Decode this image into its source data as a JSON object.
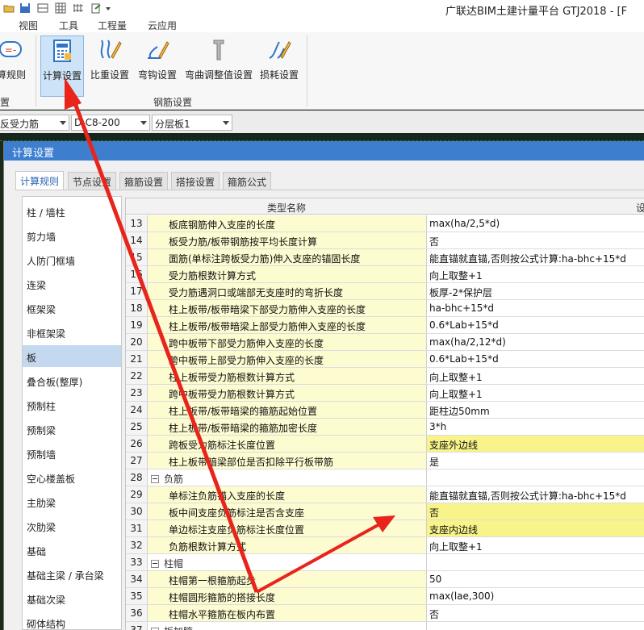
{
  "app": {
    "title": "广联达BIM土建计量平台 GTJ2018 - [F"
  },
  "menu": {
    "tabs": [
      "视图",
      "工具",
      "工程量",
      "云应用"
    ]
  },
  "ribbon": {
    "left_partial_button": "算规则",
    "left_partial_group": "置",
    "buttons": [
      "计算设置",
      "比重设置",
      "弯钩设置",
      "弯曲调整值设置",
      "损耗设置"
    ],
    "group_label": "钢筋设置"
  },
  "toolbar": {
    "combo1": "反受力筋",
    "combo2": "D-C8-200",
    "combo3": "分层板1"
  },
  "dialog": {
    "title": "计算设置",
    "tabs": [
      "计算规则",
      "节点设置",
      "箍筋设置",
      "搭接设置",
      "箍筋公式"
    ],
    "active_tab": 0,
    "categories": [
      "柱 / 墙柱",
      "剪力墙",
      "人防门框墙",
      "连梁",
      "框架梁",
      "非框架梁",
      "板",
      "叠合板(整厚)",
      "预制柱",
      "预制梁",
      "预制墙",
      "空心楼盖板",
      "主肋梁",
      "次肋梁",
      "基础",
      "基础主梁 / 承台梁",
      "基础次梁",
      "砌体结构"
    ],
    "selected_category": 6,
    "table": {
      "col_name": "类型名称",
      "col_value": "设"
    },
    "rows": [
      {
        "num": "13",
        "name": "板底钢筋伸入支座的长度",
        "value": "max(ha/2,5*d)"
      },
      {
        "num": "14",
        "name": "板受力筋/板带钢筋按平均长度计算",
        "value": "否"
      },
      {
        "num": "15",
        "name": "面筋(单标注跨板受力筋)伸入支座的锚固长度",
        "value": "能直锚就直锚,否则按公式计算:ha-bhc+15*d"
      },
      {
        "num": "16",
        "name": "受力筋根数计算方式",
        "value": "向上取整+1"
      },
      {
        "num": "17",
        "name": "受力筋遇洞口或端部无支座时的弯折长度",
        "value": "板厚-2*保护层"
      },
      {
        "num": "18",
        "name": "柱上板带/板带暗梁下部受力筋伸入支座的长度",
        "value": "ha-bhc+15*d"
      },
      {
        "num": "19",
        "name": "柱上板带/板带暗梁上部受力筋伸入支座的长度",
        "value": "0.6*Lab+15*d"
      },
      {
        "num": "20",
        "name": "跨中板带下部受力筋伸入支座的长度",
        "value": "max(ha/2,12*d)"
      },
      {
        "num": "21",
        "name": "跨中板带上部受力筋伸入支座的长度",
        "value": "0.6*Lab+15*d"
      },
      {
        "num": "22",
        "name": "柱上板带受力筋根数计算方式",
        "value": "向上取整+1"
      },
      {
        "num": "23",
        "name": "跨中板带受力筋根数计算方式",
        "value": "向上取整+1"
      },
      {
        "num": "24",
        "name": "柱上板带/板带暗梁的箍筋起始位置",
        "value": "距柱边50mm"
      },
      {
        "num": "25",
        "name": "柱上板带/板带暗梁的箍筋加密长度",
        "value": "3*h"
      },
      {
        "num": "26",
        "name": "跨板受力筋标注长度位置",
        "value": "支座外边线",
        "hl": true
      },
      {
        "num": "27",
        "name": "柱上板带暗梁部位是否扣除平行板带筋",
        "value": "是"
      },
      {
        "num": "28",
        "name": "负筋",
        "value": "",
        "group": true
      },
      {
        "num": "29",
        "name": "单标注负筋锚入支座的长度",
        "value": "能直锚就直锚,否则按公式计算:ha-bhc+15*d"
      },
      {
        "num": "30",
        "name": "板中间支座负筋标注是否含支座",
        "value": "否",
        "hl": true
      },
      {
        "num": "31",
        "name": "单边标注支座负筋标注长度位置",
        "value": "支座内边线",
        "hl": true
      },
      {
        "num": "32",
        "name": "负筋根数计算方式",
        "value": "向上取整+1"
      },
      {
        "num": "33",
        "name": "柱帽",
        "value": "",
        "group": true
      },
      {
        "num": "34",
        "name": "柱帽第一根箍筋起步",
        "value": "50"
      },
      {
        "num": "35",
        "name": "柱帽圆形箍筋的搭接长度",
        "value": "max(lae,300)"
      },
      {
        "num": "36",
        "name": "柱帽水平箍筋在板内布置",
        "value": "否"
      },
      {
        "num": "37",
        "name": "板加腋",
        "value": "",
        "group": true
      }
    ]
  },
  "colors": {
    "title_bar": "#3d7fce",
    "name_cell_bg": "#fdfbd0",
    "highlight_bg": "#f8f48a",
    "selected_bg": "#c4d8ef",
    "arrow": "#e8241b"
  }
}
